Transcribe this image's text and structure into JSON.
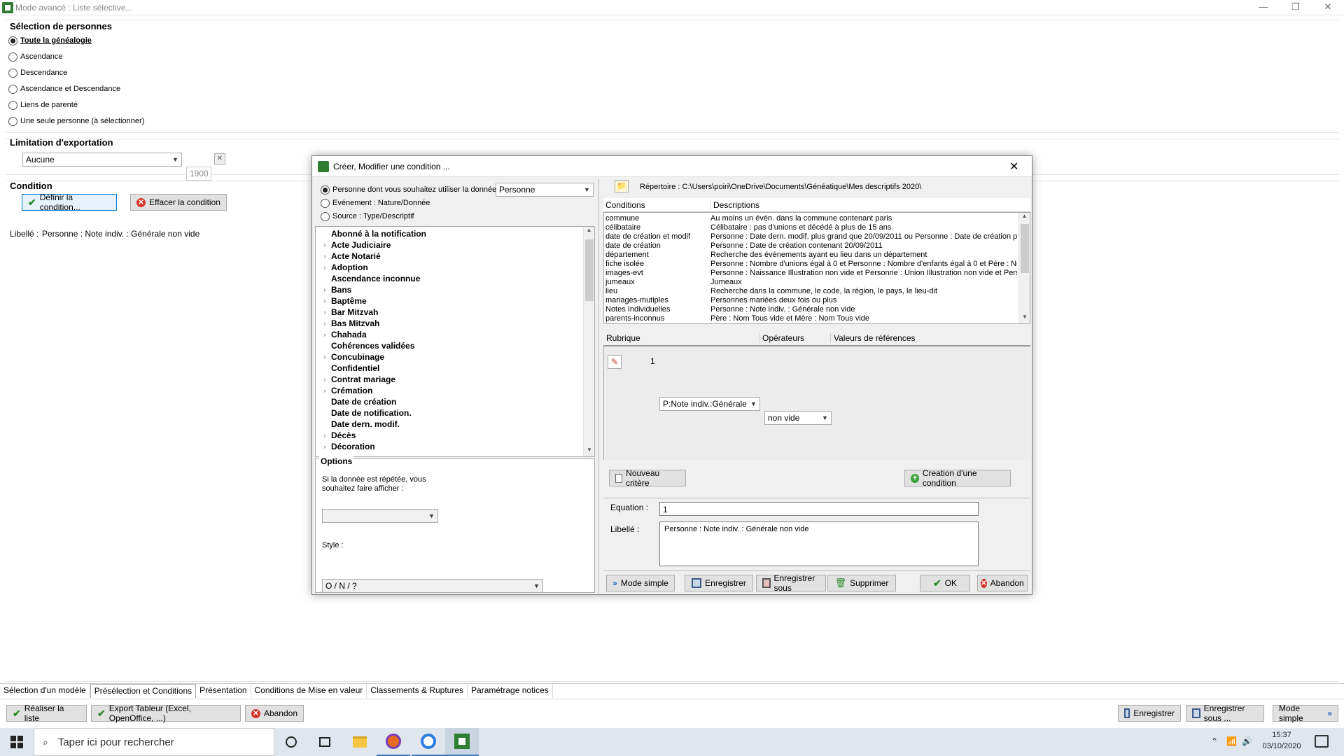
{
  "window": {
    "title": "Mode avancé : Liste sélective...",
    "min": "—",
    "max": "❐",
    "close": "✕"
  },
  "selection": {
    "title": "Sélection de personnes",
    "options": [
      {
        "label": "Toute la généalogie",
        "checked": true
      },
      {
        "label": "Ascendance",
        "checked": false
      },
      {
        "label": "Descendance",
        "checked": false
      },
      {
        "label": "Ascendance et Descendance",
        "checked": false
      },
      {
        "label": "Liens de parenté",
        "checked": false
      },
      {
        "label": "Une seule personne (à sélectionner)",
        "checked": false
      }
    ]
  },
  "limitation": {
    "title": "Limitation d'exportation",
    "value": "Aucune",
    "year": "1900"
  },
  "condition": {
    "title": "Condition",
    "define_btn": "Définir la condition...",
    "clear_btn": "Effacer la condition",
    "label_caption": "Libellé :",
    "label_value": "Personne : Note indiv. : Générale non vide"
  },
  "dialog": {
    "title": "Créer, Modifier une condition ...",
    "close": "✕",
    "source_options": [
      {
        "label": "Personne dont vous souhaitez utiliser la donnée",
        "checked": true
      },
      {
        "label": "Evénement : Nature/Donnée",
        "checked": false
      },
      {
        "label": "Source : Type/Descriptif",
        "checked": false
      }
    ],
    "source_combo": "Personne",
    "tree_items": [
      "Abonné à la notification",
      "Acte Judiciaire",
      "Acte Notarié",
      "Adoption",
      "Ascendance inconnue",
      "Bans",
      "Baptême",
      "Bar Mitzvah",
      "Bas Mitzvah",
      "Chahada",
      "Cohérences validées",
      "Concubinage",
      "Confidentiel",
      "Contrat mariage",
      "Crémation",
      "Date de création",
      "Date de notification.",
      "Date dern. modif.",
      "Décès",
      "Décoration"
    ],
    "tree_expandable": [
      false,
      true,
      true,
      true,
      false,
      true,
      true,
      true,
      true,
      true,
      false,
      true,
      false,
      true,
      true,
      false,
      false,
      false,
      true,
      true
    ],
    "options_title": "Options",
    "repeat_label_1": "Si la donnée est répétée, vous",
    "repeat_label_2": "souhaitez faire afficher :",
    "repeat_value": "",
    "style_label": "Style :",
    "style_value": "O / N / ?",
    "repertoire": "Répertoire : C:\\Users\\poiri\\OneDrive\\Documents\\Généatique\\Mes descriptifs 2020\\",
    "cond_header": {
      "conditions": "Conditions",
      "descriptions": "Descriptions"
    },
    "conditions": [
      {
        "name": "commune",
        "desc": "Au moins un évén. dans la commune contenant paris"
      },
      {
        "name": "célibataire",
        "desc": "Célibataire : pas d'unions  et décédé  à plus de 15 ans."
      },
      {
        "name": "date de création et modif",
        "desc": "Personne : Date dern. modif.  plus grand que 20/09/2011 ou Personne : Date de création  p"
      },
      {
        "name": "date de création",
        "desc": "Personne : Date de création  contenant 20/09/2011"
      },
      {
        "name": "département",
        "desc": "Recherche des évènements ayant eu lieu dans un département"
      },
      {
        "name": "fiche isolée",
        "desc": "Personne :  Nombre d'unions égal à 0 et Personne :  Nombre d'enfants égal à 0 et Père : Nor"
      },
      {
        "name": "images-evt",
        "desc": "Personne : Naissance Illustration non vide et Personne : Union Illustration non vide et Persor"
      },
      {
        "name": "jumeaux",
        "desc": "Jumeaux"
      },
      {
        "name": "lieu",
        "desc": "Recherche dans la commune, le code, la région, le pays, le lieu-dit"
      },
      {
        "name": "mariages-mutiples",
        "desc": "Personnes mariées deux fois ou plus"
      },
      {
        "name": "Notes Individuelles",
        "desc": "Personne : Note indiv. : Générale non vide"
      },
      {
        "name": "parents-inconnus",
        "desc": "Père : Nom Tous vide et Mère : Nom Tous vide"
      }
    ],
    "crit_header": {
      "rubrique": "Rubrique",
      "operateurs": "Opérateurs",
      "valeurs": "Valeurs de références"
    },
    "criterion": {
      "num": "1",
      "rubrique": "P:Note indiv.:Générale",
      "operateur": "non vide"
    },
    "nouveau_critere": "Nouveau critère",
    "creation_condition": "Creation d'une condition",
    "equation_label": "Equation :",
    "equation_value": "1",
    "libelle_label": "Libellé :",
    "libelle_value": "Personne : Note indiv. : Générale non vide",
    "buttons": {
      "mode_simple": "Mode simple",
      "enregistrer": "Enregistrer",
      "enregistrer_sous": "Enregistrer sous",
      "supprimer": "Supprimer",
      "ok": "OK",
      "abandon": "Abandon"
    }
  },
  "tabs": [
    "Sélection d'un modèle",
    "Présélection et Conditions",
    "Présentation",
    "Conditions de Mise en valeur",
    "Classements & Ruptures",
    "Paramétrage notices"
  ],
  "bottom": {
    "realiser": "Réaliser la liste",
    "export": "Export Tableur (Excel, OpenOffice, ...)",
    "abandon": "Abandon",
    "enregistrer": "Enregistrer",
    "enregistrer_sous": "Enregistrer sous ...",
    "mode_simple": "Mode simple"
  },
  "taskbar": {
    "search_placeholder": "Taper ici pour rechercher",
    "time": "15:37",
    "date": "03/10/2020"
  },
  "colors": {
    "accent": "#2e7d32",
    "taskbar": "#dfe6ee",
    "dialog_bg": "#f0f0f0"
  }
}
